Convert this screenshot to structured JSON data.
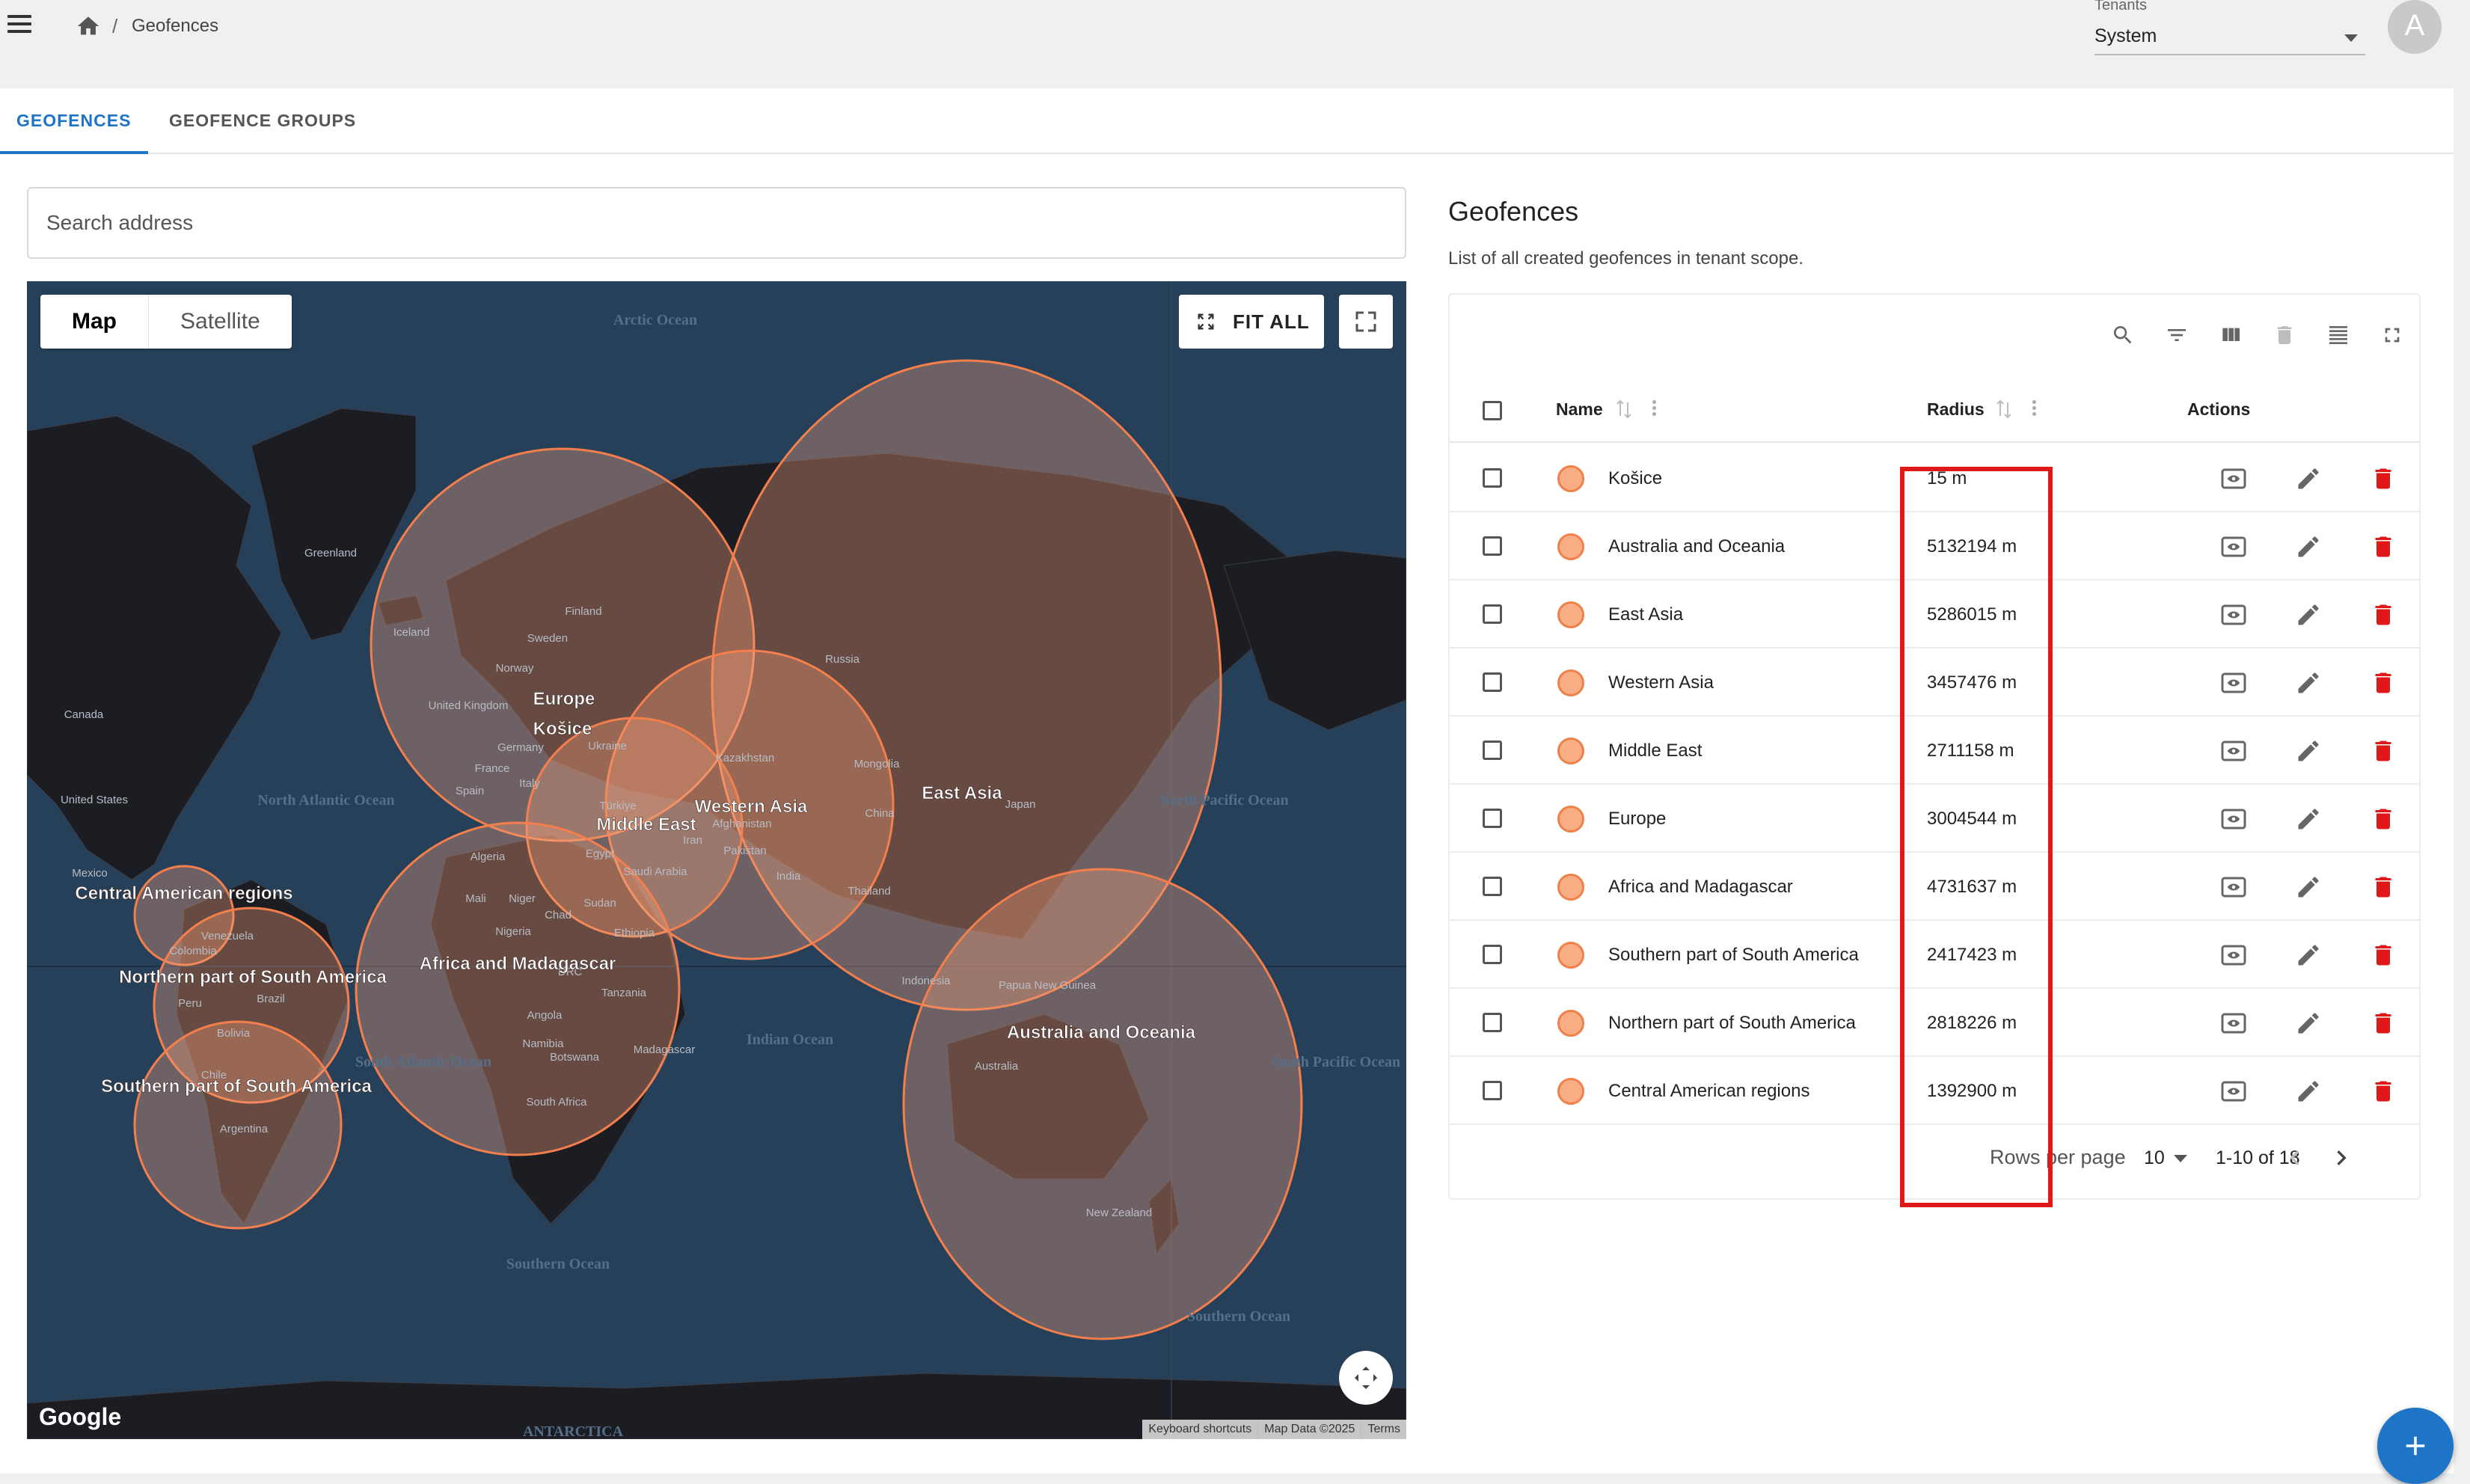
{
  "breadcrumb": {
    "current": "Geofences",
    "separator": "/"
  },
  "tenants": {
    "label": "Tenants",
    "value": "System"
  },
  "avatar": {
    "initial": "A"
  },
  "tabs": [
    {
      "label": "GEOFENCES",
      "active": true
    },
    {
      "label": "GEOFENCE GROUPS",
      "active": false
    }
  ],
  "search": {
    "placeholder": "Search address"
  },
  "map": {
    "type_options": [
      "Map",
      "Satellite"
    ],
    "selected_type": "Map",
    "fit_all_label": "FIT ALL",
    "logo": "Google",
    "attribution": [
      "Keyboard shortcuts",
      "Map Data ©2025",
      "Terms"
    ],
    "geofence_labels": [
      "Europe",
      "Košice",
      "Middle East",
      "Western Asia",
      "East Asia",
      "Central American regions",
      "Northern part of South America",
      "Southern part of South America",
      "Africa and Madagascar",
      "Australia and Oceania"
    ],
    "ocean_labels": [
      "Arctic Ocean",
      "North Atlantic Ocean",
      "North Pacific Ocean",
      "South Atlantic Ocean",
      "Indian Ocean",
      "South Pacific Ocean",
      "Southern Ocean",
      "Southern Ocean",
      "ANTARCTICA"
    ],
    "place_labels": [
      "Greenland",
      "Canada",
      "United States",
      "Mexico",
      "Iceland",
      "Finland",
      "Sweden",
      "Norway",
      "United Kingdom",
      "France",
      "Germany",
      "Spain",
      "Italy",
      "Ukraine",
      "Russia",
      "Kazakhstan",
      "Mongolia",
      "China",
      "Japan",
      "Türkiye",
      "Iran",
      "Afghanistan",
      "Pakistan",
      "Egypt",
      "Saudi Arabia",
      "India",
      "Thailand",
      "Indonesia",
      "Papua New Guinea",
      "Australia",
      "New Zealand",
      "Algeria",
      "Mali",
      "Niger",
      "Chad",
      "Sudan",
      "Ethiopia",
      "Nigeria",
      "DRC",
      "Tanzania",
      "Angola",
      "Namibia",
      "Botswana",
      "South Africa",
      "Madagascar",
      "Venezuela",
      "Colombia",
      "Peru",
      "Brazil",
      "Bolivia",
      "Chile",
      "Argentina"
    ],
    "fill_color": "#f4a07c",
    "stroke_color": "#f47f4c"
  },
  "panel": {
    "title": "Geofences",
    "subtitle": "List of all created geofences in tenant scope."
  },
  "table": {
    "columns": {
      "name": "Name",
      "radius": "Radius",
      "actions": "Actions"
    },
    "rows": [
      {
        "name": "Košice",
        "radius": "15 m"
      },
      {
        "name": "Australia and Oceania",
        "radius": "5132194 m"
      },
      {
        "name": "East Asia",
        "radius": "5286015 m"
      },
      {
        "name": "Western Asia",
        "radius": "3457476 m"
      },
      {
        "name": "Middle East",
        "radius": "2711158 m"
      },
      {
        "name": "Europe",
        "radius": "3004544 m"
      },
      {
        "name": "Africa and Madagascar",
        "radius": "4731637 m"
      },
      {
        "name": "Southern part of South America",
        "radius": "2417423 m"
      },
      {
        "name": "Northern part of South America",
        "radius": "2818226 m"
      },
      {
        "name": "Central American regions",
        "radius": "1392900 m"
      }
    ],
    "pagination": {
      "rows_per_page_label": "Rows per page",
      "rows_per_page": "10",
      "range": "1-10 of 18"
    }
  },
  "colors": {
    "accent": "#1e74c6",
    "delete": "#e01818",
    "highlight": "#e01818"
  }
}
